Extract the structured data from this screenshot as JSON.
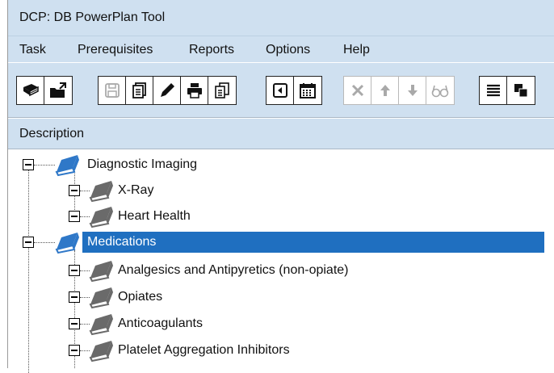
{
  "window": {
    "title": "DCP: DB PowerPlan Tool"
  },
  "menu": [
    "Task",
    "Prerequisites",
    "Reports",
    "Options",
    "Help"
  ],
  "toolbar": {
    "groups": [
      {
        "enabled": true,
        "buttons": [
          "open-book-icon",
          "import-folder-icon"
        ]
      },
      {
        "enabled": true,
        "buttons": [
          "save-icon",
          "copy-document-icon",
          "edit-pencil-icon",
          "print-icon",
          "copy-pages-icon"
        ]
      },
      {
        "enabled": true,
        "buttons": [
          "import-file-icon",
          "calendar-icon"
        ]
      },
      {
        "enabled": false,
        "buttons": [
          "delete-icon",
          "move-up-icon",
          "move-down-icon",
          "view-glasses-icon"
        ]
      },
      {
        "enabled": true,
        "buttons": [
          "list-icon",
          "cascade-windows-icon"
        ]
      }
    ]
  },
  "header": {
    "column": "Description"
  },
  "tree": {
    "groups": [
      {
        "label": "Diagnostic Imaging",
        "expanded": true,
        "selected": false,
        "children": [
          {
            "label": "X-Ray"
          },
          {
            "label": "Heart Health"
          }
        ]
      },
      {
        "label": "Medications",
        "expanded": true,
        "selected": true,
        "children": [
          {
            "label": "Analgesics and Antipyretics (non-opiate)"
          },
          {
            "label": "Opiates"
          },
          {
            "label": "Anticoagulants"
          },
          {
            "label": "Platelet Aggregation Inhibitors"
          }
        ]
      }
    ]
  },
  "colors": {
    "chrome": "#cfe0f0",
    "selection": "#1f6fc0",
    "folder_icon": "#2f78c8",
    "item_icon": "#6a6a6a"
  }
}
